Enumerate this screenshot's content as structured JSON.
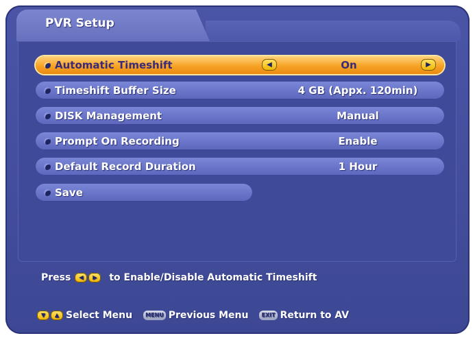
{
  "title": "PVR Setup",
  "menu": [
    {
      "label": "Automatic Timeshift",
      "value": "On"
    },
    {
      "label": "Timeshift Buffer Size",
      "value": "4 GB (Appx. 120min)"
    },
    {
      "label": "DISK Management",
      "value": "Manual"
    },
    {
      "label": "Prompt On Recording",
      "value": "Enable"
    },
    {
      "label": "Default Record Duration",
      "value": "1 Hour"
    },
    {
      "label": "Save",
      "value": ""
    }
  ],
  "selected_index": 0,
  "help": {
    "press": "Press",
    "text": "to Enable/Disable Automatic Timeshift"
  },
  "footer": {
    "select_menu": "Select Menu",
    "menu_key": "MENU",
    "previous_menu": "Previous Menu",
    "exit_key": "EXIT",
    "return_to_av": "Return to AV"
  },
  "colors": {
    "background": "#3f4a98",
    "highlight": "#f6a325",
    "row": "#6a75c8",
    "key_yellow": "#f0b400"
  },
  "icons": {
    "left_arrow": "left-arrow-key-icon",
    "right_arrow": "right-arrow-key-icon",
    "down_arrow": "down-arrow-key-icon",
    "up_arrow": "up-arrow-key-icon"
  }
}
